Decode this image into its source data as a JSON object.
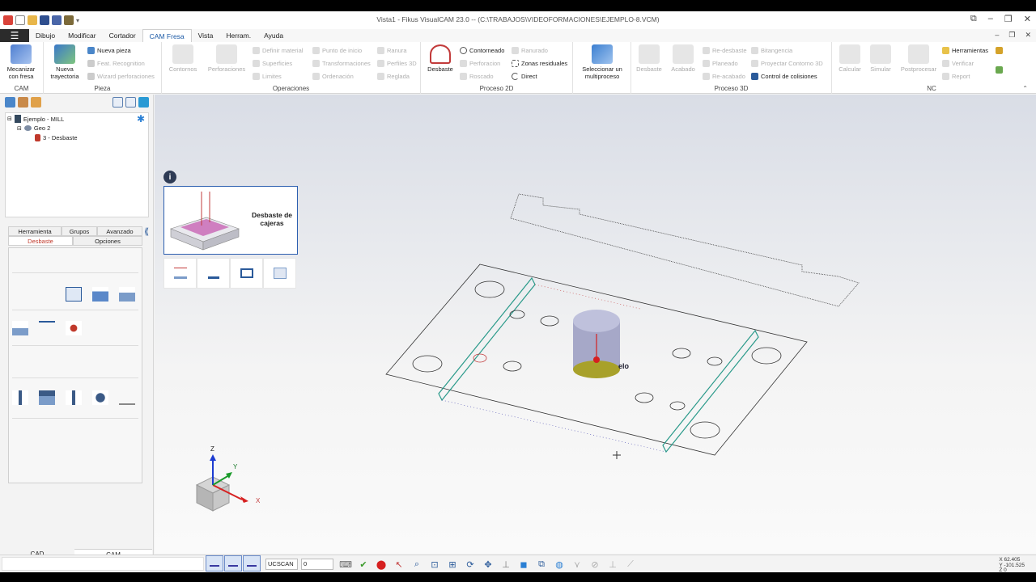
{
  "window": {
    "title": "Vista1 - Fikus VisualCAM 23.0 -- (C:\\TRABAJOS\\VIDEOFORMACIONES\\EJEMPLO-8.VCM)"
  },
  "menu": {
    "tabs": [
      "Dibujo",
      "Modificar",
      "Cortador",
      "CAM Fresa",
      "Vista",
      "Herram.",
      "Ayuda"
    ],
    "active": "CAM Fresa"
  },
  "ribbon": {
    "cam": {
      "label": "CAM",
      "mecanizar": "Mecanizar con fresa"
    },
    "pieza": {
      "label": "Pieza",
      "nueva_trayectoria": "Nueva trayectoria",
      "nueva_pieza": "Nueva pieza",
      "feat_recognition": "Feat. Recognition",
      "wizard_perforaciones": "Wizard perforaciones"
    },
    "operaciones": {
      "label": "Operaciones",
      "contornos": "Contornos",
      "perforaciones": "Perforaciones",
      "definir_material": "Definir material",
      "superficies": "Superficies",
      "limites": "Limites",
      "punto_inicio": "Punto de inicio",
      "transformaciones": "Transformaciones",
      "ordenacion": "Ordenación",
      "ranura": "Ranura",
      "perfiles_3d": "Perfiles 3D",
      "reglada": "Reglada"
    },
    "proceso2d": {
      "label": "Proceso 2D",
      "desbaste": "Desbaste",
      "contorneado": "Contorneado",
      "perforacion": "Perforacion",
      "roscado": "Roscado",
      "ranurado": "Ranurado",
      "zonas_residuales": "Zonas residuales",
      "direct": "Direct"
    },
    "multiproceso": {
      "seleccionar": "Seleccionar un multiproceso"
    },
    "proceso3d": {
      "label": "Proceso 3D",
      "desbaste": "Desbaste",
      "acabado": "Acabado",
      "re_desbaste": "Re-desbaste",
      "planeado": "Planeado",
      "re_acabado": "Re-acabado",
      "bitangencia": "Bitangencia",
      "proyectar_contorno": "Proyectar Contorno 3D",
      "control_colisiones": "Control de colisiones"
    },
    "nc": {
      "label": "NC",
      "calcular": "Calcular",
      "simular": "Simular",
      "postprocesar": "Postprocesar",
      "herramientas": "Herramientas",
      "verificar": "Verificar",
      "report": "Report"
    }
  },
  "tree": {
    "root": "Ejemplo - MILL",
    "geo": "Geo 2",
    "op": "3 - Desbaste"
  },
  "op_panel": {
    "tabs": [
      "Herramienta",
      "Grupos",
      "Avanzado"
    ],
    "subtabs": [
      "Desbaste",
      "Opciones"
    ],
    "active_subtab": "Desbaste"
  },
  "bottom_tabs": [
    "CAD",
    "CAM"
  ],
  "viewport": {
    "strategy_title": "Desbaste de cajeras",
    "part_label": "elo",
    "axis_x": "X",
    "axis_y": "Y",
    "axis_z": "Z"
  },
  "status": {
    "ucs": "UCSCAN",
    "ucs_value": "0",
    "coord_x": "X 62.405",
    "coord_y": "Y -101.525",
    "coord_z": "Z 0"
  },
  "colors": {
    "accent": "#1c5aa6",
    "active_tab_text": "#c0392b",
    "part_edge": "#2a9a8a"
  }
}
